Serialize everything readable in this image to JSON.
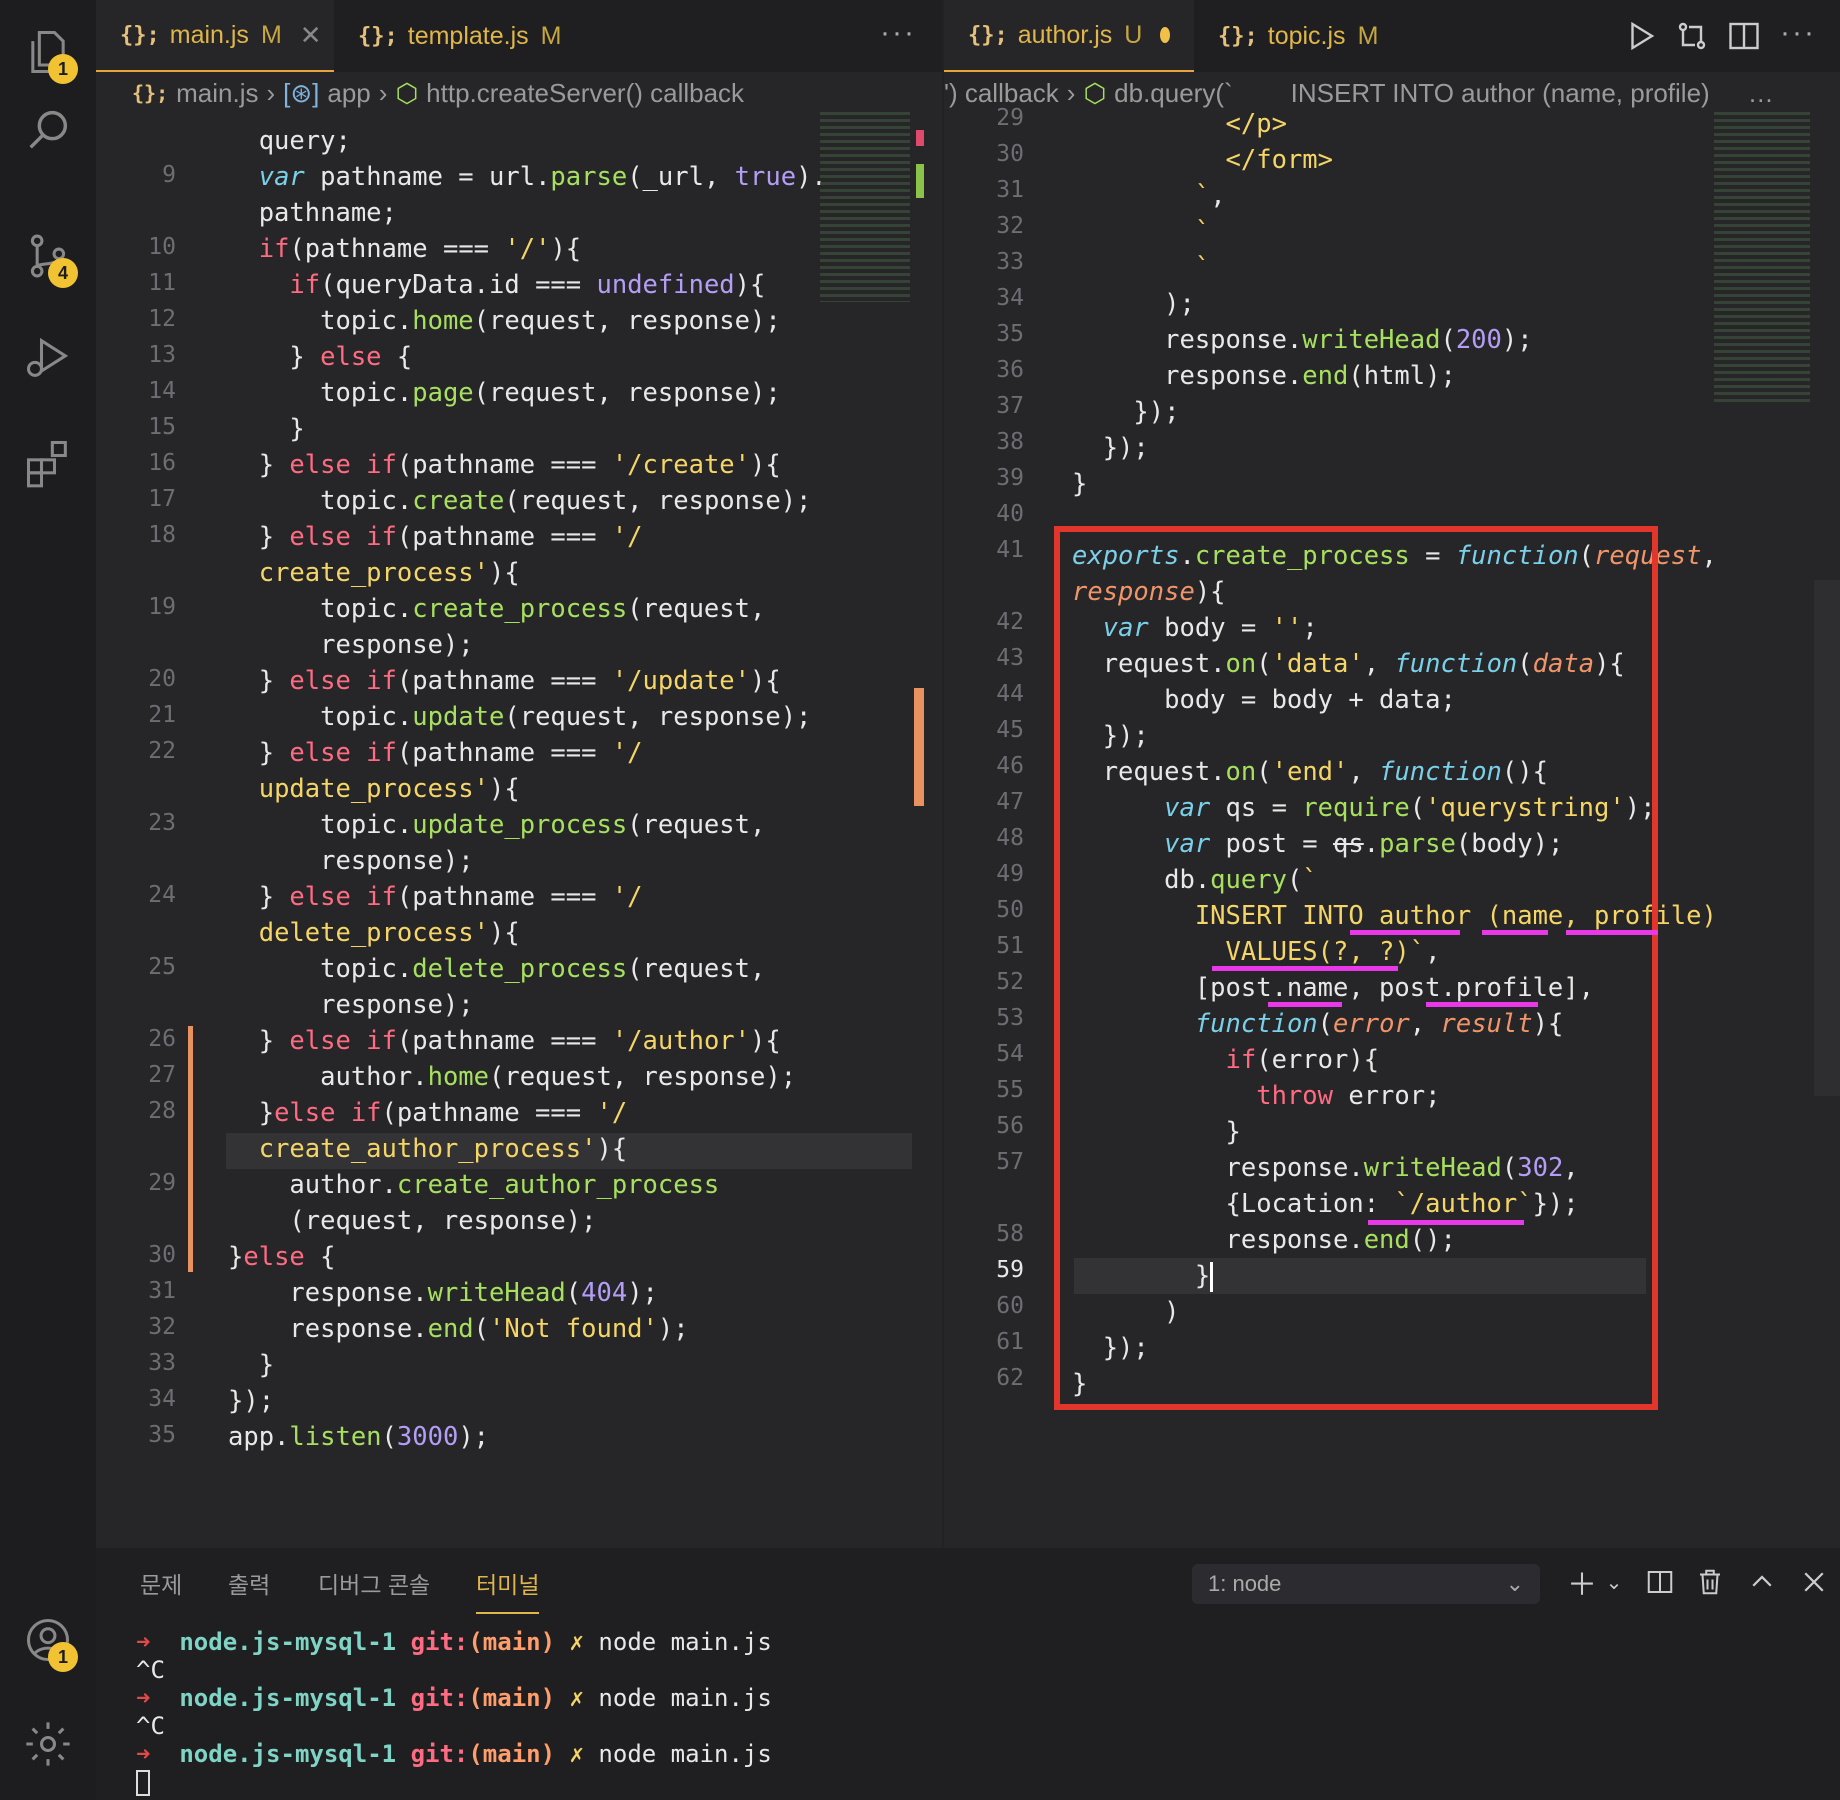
{
  "activity": {
    "explorer_badge": "1",
    "scm_badge": "4",
    "account_badge": "1"
  },
  "left": {
    "tabs": [
      {
        "label": "main.js",
        "status": "M"
      },
      {
        "label": "template.js",
        "status": "M"
      }
    ],
    "more": "···",
    "breadcrumb": [
      "main.js",
      "app",
      "http.createServer() callback"
    ],
    "line_numbers": [
      "9",
      "10",
      "11",
      "12",
      "13",
      "14",
      "15",
      "16",
      "17",
      "18",
      "19",
      "20",
      "21",
      "22",
      "23",
      "24",
      "25",
      "26",
      "27",
      "28",
      "29",
      "30",
      "31",
      "32",
      "33",
      "34",
      "35"
    ]
  },
  "right": {
    "tabs": [
      {
        "label": "author.js",
        "status": "U"
      },
      {
        "label": "topic.js",
        "status": "M"
      }
    ],
    "more": "···",
    "breadcrumb": [
      "') callback",
      "db.query(`",
      "INSERT INTO author (name, profile)",
      "…"
    ],
    "line_numbers": [
      "29",
      "30",
      "31",
      "32",
      "33",
      "34",
      "35",
      "36",
      "37",
      "38",
      "39",
      "40",
      "41",
      "42",
      "43",
      "44",
      "45",
      "46",
      "47",
      "48",
      "49",
      "50",
      "51",
      "52",
      "53",
      "54",
      "55",
      "56",
      "57",
      "58",
      "59",
      "60",
      "61",
      "62"
    ],
    "current_line": "59"
  },
  "panel": {
    "tabs": [
      "문제",
      "출력",
      "디버그 콘솔",
      "터미널"
    ],
    "active_tab": "터미널",
    "terminal_select": "1: node",
    "prompt_arrow": "➜",
    "dir": "node.js-mysql-1",
    "git": "git:",
    "branch": "(main)",
    "dirty": "✗",
    "command": "node main.js",
    "interrupt": "^C"
  }
}
